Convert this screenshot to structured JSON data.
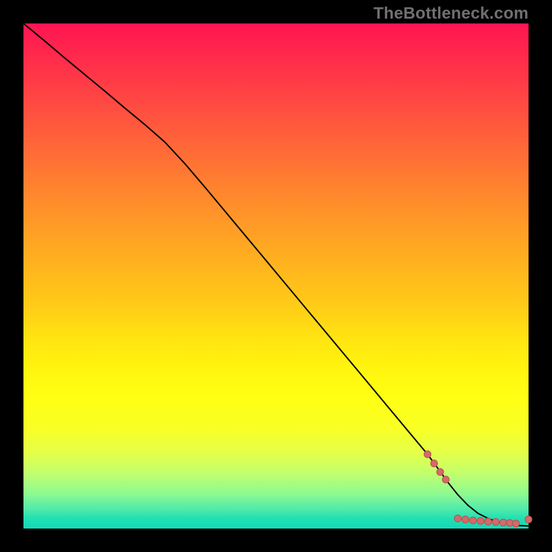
{
  "watermark": "TheBottleneck.com",
  "colors": {
    "frame": "#000000",
    "curve": "#000000",
    "dot_fill": "#d46a6a",
    "dot_stroke": "#b94e4e"
  },
  "chart_data": {
    "type": "line",
    "title": "",
    "xlabel": "",
    "ylabel": "",
    "xlim": [
      0,
      100
    ],
    "ylim": [
      0,
      100
    ],
    "grid": false,
    "legend": false,
    "series": [
      {
        "name": "curve",
        "x": [
          0,
          4,
          8,
          12,
          16,
          20,
          24,
          28,
          32,
          36,
          40,
          44,
          48,
          52,
          56,
          60,
          64,
          68,
          72,
          76,
          80,
          82,
          84,
          86,
          88,
          90,
          92,
          94,
          96,
          98,
          100
        ],
        "y": [
          100,
          96.7,
          93.3,
          90.0,
          86.7,
          83.3,
          80.0,
          76.5,
          72.2,
          67.5,
          62.7,
          57.9,
          53.1,
          48.3,
          43.5,
          38.7,
          33.9,
          29.1,
          24.3,
          19.5,
          14.7,
          12.0,
          9.2,
          6.7,
          4.6,
          3.0,
          2.0,
          1.3,
          0.9,
          0.6,
          0.5
        ]
      }
    ],
    "scatter": {
      "name": "dots",
      "x": [
        80.0,
        81.3,
        82.5,
        83.6,
        86.0,
        87.5,
        89.0,
        90.5,
        92.0,
        93.5,
        95.0,
        96.3,
        97.5,
        100.0
      ],
      "y": [
        14.7,
        12.9,
        11.2,
        9.7,
        2.0,
        1.8,
        1.6,
        1.5,
        1.4,
        1.3,
        1.2,
        1.1,
        1.0,
        1.8
      ]
    }
  }
}
